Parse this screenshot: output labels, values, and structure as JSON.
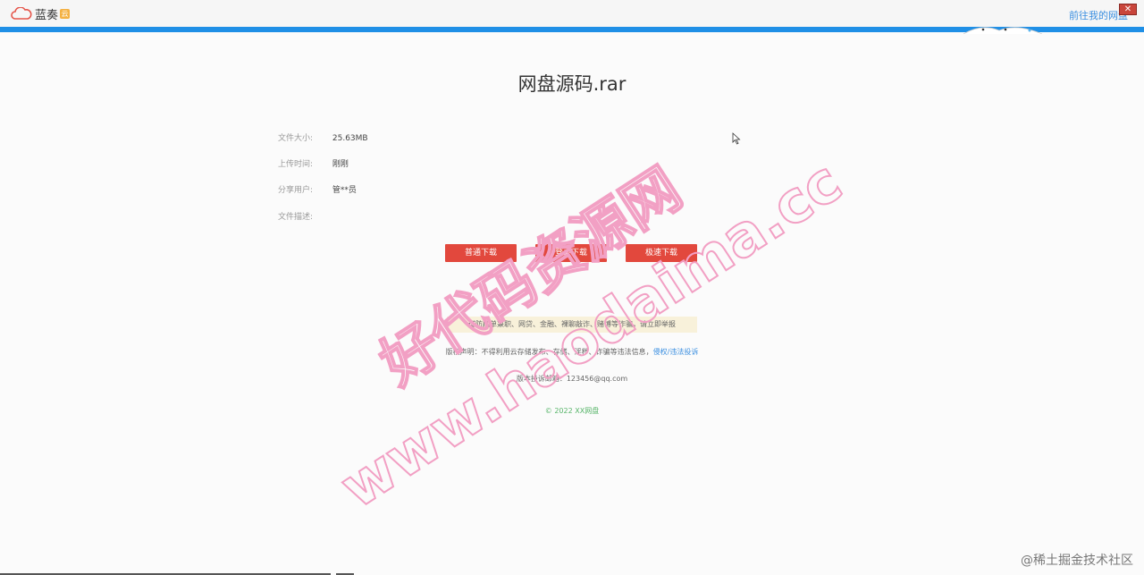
{
  "topbar": {
    "logo_text": "蓝奏",
    "logo_badge": "云",
    "link_text": "前往我的网盘",
    "close_text": "✕"
  },
  "file": {
    "title": "网盘源码.rar",
    "info": [
      {
        "label": "文件大小:",
        "value": "25.63MB"
      },
      {
        "label": "上传时间:",
        "value": "刚刚"
      },
      {
        "label": "分享用户:",
        "value": "管**员"
      },
      {
        "label": "文件描述:",
        "value": ""
      }
    ]
  },
  "buttons": {
    "normal": "普通下载",
    "login": "登录下载",
    "fast": "极速下载"
  },
  "notice": {
    "text": "谨防刷单兼职、网贷、金融、裸聊敲诈、赌博等诈骗，请立即举报"
  },
  "copyright": {
    "text": "版权声明：不得利用云存储发布、存储、淫秽、诈骗等违法信息，",
    "link": "侵权/违法投诉"
  },
  "contact": {
    "text": "版本投诉邮箱：123456@qq.com"
  },
  "footer": {
    "text": "© 2022 XX网盘"
  },
  "watermark": {
    "line1": "好代码资源网",
    "line2": "www.haodaima.cc",
    "color": "#f2a0c4"
  },
  "attribution": {
    "text": "@稀土掘金技术社区"
  },
  "colors": {
    "accent_blue": "#1f8fe6",
    "button_red": "#e2483d",
    "notice_bg": "#f8f1da",
    "footer_green": "#58b56a"
  }
}
